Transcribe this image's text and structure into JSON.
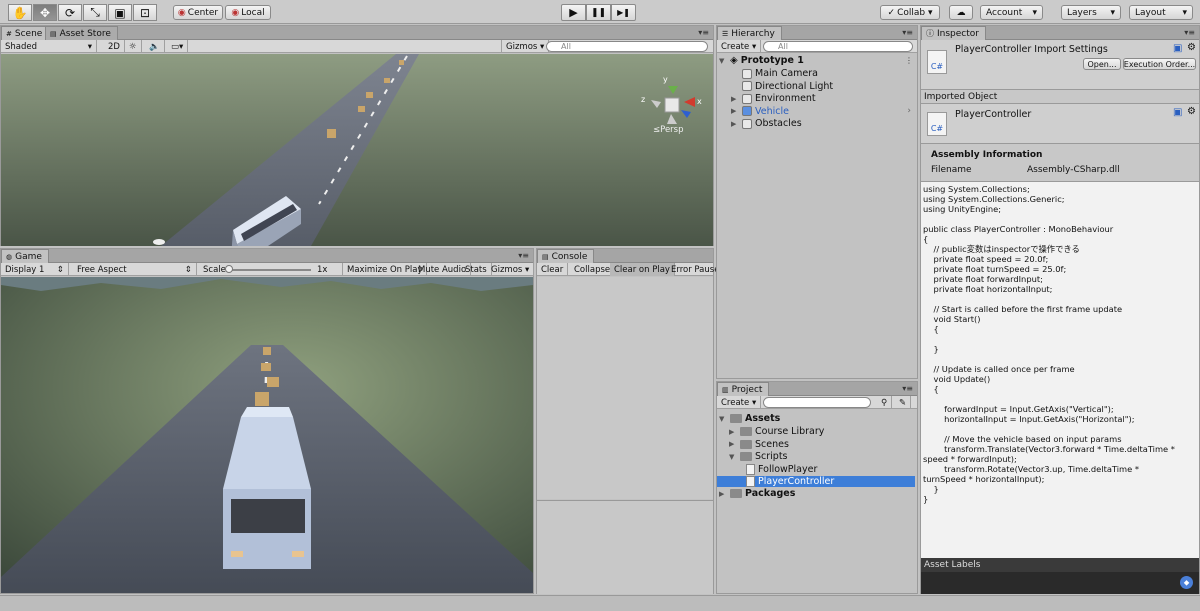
{
  "toolbar": {
    "tools": [
      {
        "name": "hand-tool",
        "glyph": "✋"
      },
      {
        "name": "move-tool",
        "glyph": "✥"
      },
      {
        "name": "rotate-tool",
        "glyph": "⟳"
      },
      {
        "name": "scale-tool",
        "glyph": "⤡"
      },
      {
        "name": "rect-tool",
        "glyph": "▣"
      },
      {
        "name": "transform-tool",
        "glyph": "⊡"
      }
    ],
    "pivot_label": "Center",
    "space_label": "Local",
    "play_glyph": "▶",
    "pause_glyph": "❚❚",
    "step_glyph": "▶❚",
    "collab_label": "Collab ▾",
    "account_label": "Account",
    "layers_label": "Layers",
    "layout_label": "Layout"
  },
  "scene": {
    "tab_label": "Scene",
    "asset_store_tab": "Asset Store",
    "shading_mode": "Shaded",
    "mode_2d": "2D",
    "gizmos_label": "Gizmos",
    "search_placeholder": "All",
    "persp_label": "≤Persp"
  },
  "game": {
    "tab_label": "Game",
    "display": "Display 1",
    "aspect": "Free Aspect",
    "scale_label": "Scale",
    "scale_value": "1x",
    "maximize_label": "Maximize On Play",
    "mute_label": "Mute Audio",
    "stats_label": "Stats",
    "gizmos_label": "Gizmos"
  },
  "console": {
    "tab_label": "Console",
    "clear": "Clear",
    "collapse": "Collapse",
    "clear_on_play": "Clear on Play",
    "error_pause": "Error Pause"
  },
  "hierarchy": {
    "tab_label": "Hierarchy",
    "create_label": "Create",
    "search_placeholder": "All",
    "scene_name": "Prototype 1",
    "items": [
      {
        "label": "Main Camera",
        "expandable": false,
        "color": "#111"
      },
      {
        "label": "Directional Light",
        "expandable": false,
        "color": "#111"
      },
      {
        "label": "Environment",
        "expandable": true,
        "color": "#111"
      },
      {
        "label": "Vehicle",
        "expandable": true,
        "color": "#2a5fc0"
      },
      {
        "label": "Obstacles",
        "expandable": true,
        "color": "#111"
      }
    ]
  },
  "project": {
    "tab_label": "Project",
    "create_label": "Create",
    "root": "Assets",
    "items": [
      {
        "label": "Course Library",
        "type": "folder"
      },
      {
        "label": "Scenes",
        "type": "folder"
      },
      {
        "label": "Scripts",
        "type": "folder"
      },
      {
        "label": "FollowPlayer",
        "type": "script"
      },
      {
        "label": "PlayerController",
        "type": "script"
      }
    ],
    "packages": "Packages"
  },
  "inspector": {
    "tab_label": "Inspector",
    "title": "PlayerController Import Settings",
    "open_label": "Open...",
    "exec_order_label": "Execution Order...",
    "icon_text": "C#",
    "imported_object": "Imported Object",
    "object_name": "PlayerController",
    "assembly_heading": "Assembly Information",
    "filename_label": "Filename",
    "filename_value": "Assembly-CSharp.dll",
    "code": "using System.Collections;\nusing System.Collections.Generic;\nusing UnityEngine;\n\npublic class PlayerController : MonoBehaviour\n{\n    // public変数はinspectorで操作できる\n    private float speed = 20.0f;\n    private float turnSpeed = 25.0f;\n    private float forwardInput;\n    private float horizontalInput;\n\n    // Start is called before the first frame update\n    void Start()\n    {\n\n    }\n\n    // Update is called once per frame\n    void Update()\n    {\n\n        forwardInput = Input.GetAxis(\"Vertical\");\n        horizontalInput = Input.GetAxis(\"Horizontal\");\n\n        // Move the vehicle based on input params\n        transform.Translate(Vector3.forward * Time.deltaTime *\nspeed * forwardInput);\n        transform.Rotate(Vector3.up, Time.deltaTime *\nturnSpeed * horizontalInput);\n    }\n}",
    "asset_labels": "Asset Labels"
  }
}
